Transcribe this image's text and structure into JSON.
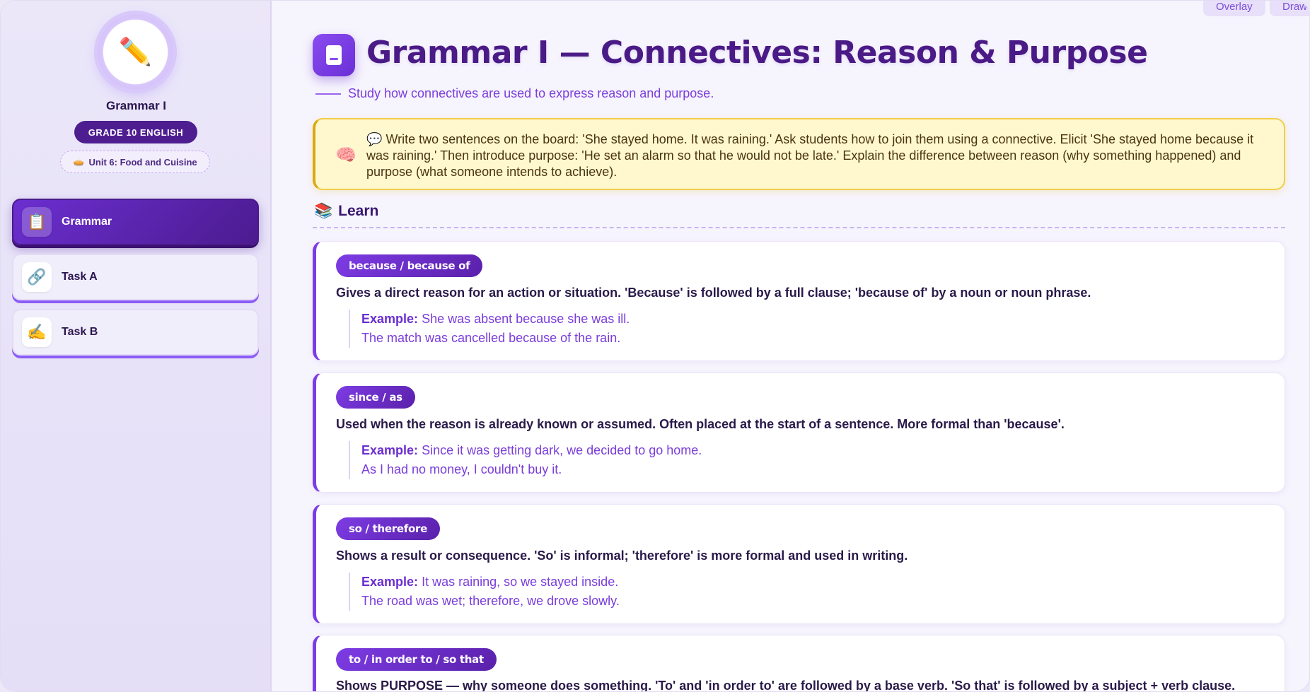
{
  "sidebar": {
    "title": "Grammar I",
    "grade": "GRADE 10 ENGLISH",
    "unit_emoji": "🥧",
    "unit": "Unit 6: Food and Cuisine",
    "avatar_icon": "✏️",
    "nav": [
      {
        "label": "Grammar",
        "icon": "📋",
        "active": true
      },
      {
        "label": "Task A",
        "icon": "🔗",
        "active": false
      },
      {
        "label": "Task B",
        "icon": "✍️",
        "active": false
      }
    ]
  },
  "top_tabs": [
    "Overlay",
    "Draw"
  ],
  "header": {
    "title": "Grammar I — Connectives: Reason & Purpose",
    "subtitle": "Study how connectives are used to express reason and purpose."
  },
  "teacher_note": {
    "icon": "🧠",
    "speech_icon": "💬",
    "text": "Write two sentences on the board: 'She stayed home. It was raining.' Ask students how to join them using a connective. Elicit 'She stayed home because it was raining.' Then introduce purpose: 'He set an alarm so that he would not be late.' Explain the difference between reason (why something happened) and purpose (what someone intends to achieve)."
  },
  "learn": {
    "icon": "📚",
    "heading": "Learn",
    "example_label": "Example:",
    "cards": [
      {
        "tag": "because / because of",
        "desc": "Gives a direct reason for an action or situation. 'Because' is followed by a full clause; 'because of' by a noun or noun phrase.",
        "ex1": "She was absent because she was ill.",
        "ex2": "The match was cancelled because of the rain."
      },
      {
        "tag": "since / as",
        "desc": "Used when the reason is already known or assumed. Often placed at the start of a sentence. More formal than 'because'.",
        "ex1": "Since it was getting dark, we decided to go home.",
        "ex2": "As I had no money, I couldn't buy it."
      },
      {
        "tag": "so / therefore",
        "desc": "Shows a result or consequence. 'So' is informal; 'therefore' is more formal and used in writing.",
        "ex1": "It was raining, so we stayed inside.",
        "ex2": "The road was wet; therefore, we drove slowly."
      },
      {
        "tag": "to / in order to / so that",
        "desc": "Shows PURPOSE — why someone does something. 'To' and 'in order to' are followed by a base verb. 'So that' is followed by a subject + verb clause."
      }
    ]
  },
  "colors": {
    "accent": "#7c3ce6",
    "nav_active": "#5a20aa",
    "note_bg": "#fff8cf",
    "note_border": "#f0cd4a"
  }
}
